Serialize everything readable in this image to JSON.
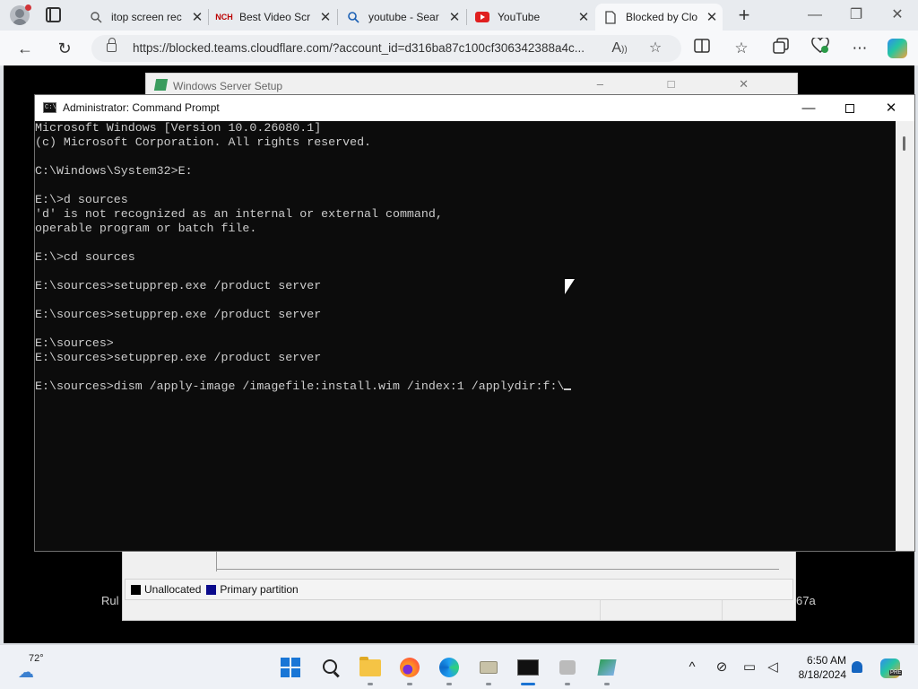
{
  "browser": {
    "tabs": [
      {
        "title": "itop screen rec",
        "favicon": "search-icon"
      },
      {
        "title": "Best Video Scr",
        "favicon": "nch-logo"
      },
      {
        "title": "youtube - Sear",
        "favicon": "search-icon"
      },
      {
        "title": "YouTube",
        "favicon": "youtube-logo"
      },
      {
        "title": "Blocked by Clo",
        "favicon": "page-icon"
      }
    ],
    "url": "https://blocked.teams.cloudflare.com/?account_id=d316ba87c100cf306342388a4c..."
  },
  "remote": {
    "background_window_title": "Windows Server Setup",
    "legend": [
      {
        "label": "Unallocated",
        "color": "#000000"
      },
      {
        "label": "Primary partition",
        "color": "#0a0a8c"
      }
    ],
    "side_text_left": "Rul",
    "side_text_right": "67a"
  },
  "cmd": {
    "title": "Administrator: Command Prompt",
    "lines": [
      "Microsoft Windows [Version 10.0.26080.1]",
      "(c) Microsoft Corporation. All rights reserved.",
      "",
      "C:\\Windows\\System32>E:",
      "",
      "E:\\>d sources",
      "'d' is not recognized as an internal or external command,",
      "operable program or batch file.",
      "",
      "E:\\>cd sources",
      "",
      "E:\\sources>setupprep.exe /product server",
      "",
      "E:\\sources>setupprep.exe /product server",
      "",
      "E:\\sources>",
      "E:\\sources>setupprep.exe /product server",
      "",
      "E:\\sources>dism /apply-image /imagefile:install.wim /index:1 /applydir:f:\\"
    ]
  },
  "taskbar": {
    "temperature": "72°",
    "time": "6:50 AM",
    "date": "8/18/2024"
  }
}
